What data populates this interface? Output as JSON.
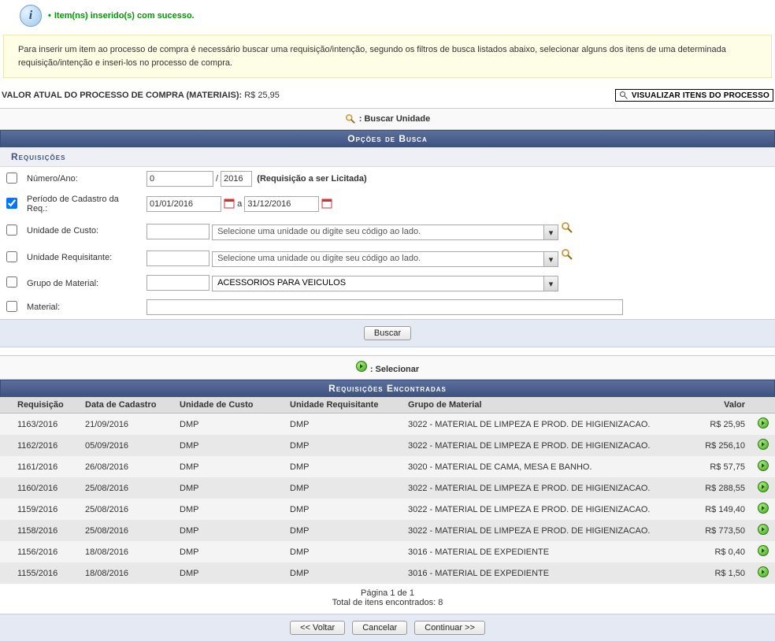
{
  "success_message": "Item(ns) inserido(s) com sucesso.",
  "info_box": "Para inserir um item ao processo de compra é necessário buscar uma requisição/intenção, segundo os filtros de busca listados abaixo, selecionar alguns dos itens de uma determinada requisição/intenção e inseri-los no processo de compra.",
  "valor_atual": {
    "label": "VALOR ATUAL DO PROCESSO DE COMPRA (MATERIAIS):",
    "value": "R$ 25,95"
  },
  "btn_visualizar": "VISUALIZAR ITENS DO PROCESSO",
  "legend_buscar_unidade": ": Buscar Unidade",
  "section_opcoes": "Opções de Busca",
  "section_req": "Requisições",
  "filters": {
    "numero_ano": {
      "label": "Número/Ano:",
      "numero": "0",
      "ano": "2016",
      "hint": "(Requisição a ser Licitada)"
    },
    "periodo": {
      "label": "Período de Cadastro da Req.:",
      "inicio": "01/01/2016",
      "sep": "a",
      "fim": "31/12/2016"
    },
    "unidade_custo": {
      "label": "Unidade de Custo:",
      "placeholder": "Selecione uma unidade ou digite seu código ao lado."
    },
    "unidade_req": {
      "label": "Unidade Requisitante:",
      "placeholder": "Selecione uma unidade ou digite seu código ao lado."
    },
    "grupo_material": {
      "label": "Grupo de Material:",
      "value": "ACESSORIOS PARA VEICULOS"
    },
    "material": {
      "label": "Material:"
    }
  },
  "btn_buscar": "Buscar",
  "legend_selecionar": ": Selecionar",
  "section_encontradas": "Requisições Encontradas",
  "table_headers": {
    "requisicao": "Requisição",
    "data": "Data de Cadastro",
    "uc": "Unidade de Custo",
    "ur": "Unidade Requisitante",
    "grupo": "Grupo de Material",
    "valor": "Valor"
  },
  "rows": [
    {
      "req": "1163/2016",
      "data": "21/09/2016",
      "uc": "DMP",
      "ur": "DMP",
      "grupo": "3022 - MATERIAL DE LIMPEZA E PROD. DE HIGIENIZACAO.",
      "valor": "R$ 25,95"
    },
    {
      "req": "1162/2016",
      "data": "05/09/2016",
      "uc": "DMP",
      "ur": "DMP",
      "grupo": "3022 - MATERIAL DE LIMPEZA E PROD. DE HIGIENIZACAO.",
      "valor": "R$ 256,10"
    },
    {
      "req": "1161/2016",
      "data": "26/08/2016",
      "uc": "DMP",
      "ur": "DMP",
      "grupo": "3020 - MATERIAL DE CAMA, MESA E BANHO.",
      "valor": "R$ 57,75"
    },
    {
      "req": "1160/2016",
      "data": "25/08/2016",
      "uc": "DMP",
      "ur": "DMP",
      "grupo": "3022 - MATERIAL DE LIMPEZA E PROD. DE HIGIENIZACAO.",
      "valor": "R$ 288,55"
    },
    {
      "req": "1159/2016",
      "data": "25/08/2016",
      "uc": "DMP",
      "ur": "DMP",
      "grupo": "3022 - MATERIAL DE LIMPEZA E PROD. DE HIGIENIZACAO.",
      "valor": "R$ 149,40"
    },
    {
      "req": "1158/2016",
      "data": "25/08/2016",
      "uc": "DMP",
      "ur": "DMP",
      "grupo": "3022 - MATERIAL DE LIMPEZA E PROD. DE HIGIENIZACAO.",
      "valor": "R$ 773,50"
    },
    {
      "req": "1156/2016",
      "data": "18/08/2016",
      "uc": "DMP",
      "ur": "DMP",
      "grupo": "3016 - MATERIAL DE EXPEDIENTE",
      "valor": "R$ 0,40"
    },
    {
      "req": "1155/2016",
      "data": "18/08/2016",
      "uc": "DMP",
      "ur": "DMP",
      "grupo": "3016 - MATERIAL DE EXPEDIENTE",
      "valor": "R$ 1,50"
    }
  ],
  "pagination": {
    "page": "Página 1 de 1",
    "total": "Total de itens encontrados: 8"
  },
  "footer": {
    "voltar": "<< Voltar",
    "cancelar": "Cancelar",
    "continuar": "Continuar >>"
  }
}
